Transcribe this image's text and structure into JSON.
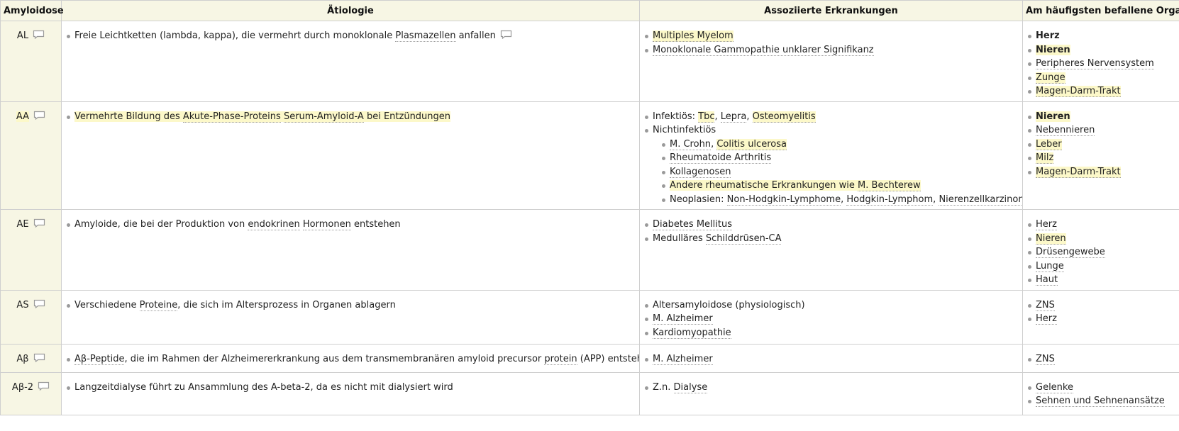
{
  "table": {
    "headers": [
      "Amyloidose",
      "Ätiologie",
      "Assoziierte Erkrankungen",
      "Am häufigsten befallene Organe"
    ],
    "rows": [
      {
        "type": "AL",
        "etiology": [
          "Freie Leichtketten (lambda, kappa), die vermehrt durch monoklonale ",
          "Plasmazellen",
          " anfallen"
        ],
        "diseases": [
          {
            "parts": [
              {
                "t": "Multiples Myelom",
                "hl": true,
                "lk": true
              }
            ]
          },
          {
            "parts": [
              {
                "t": "Monoklonale Gammopathie unklarer Signifikanz",
                "lk": true
              }
            ]
          }
        ],
        "organs": [
          {
            "t": "Herz",
            "b": true
          },
          {
            "t": "Nieren",
            "b": true,
            "hl": true
          },
          {
            "t": "Peripheres Nervensystem",
            "lk": true
          },
          {
            "t": "Zunge",
            "hl": true,
            "lk": true
          },
          {
            "t": "Magen-Darm-Trakt",
            "hl": true,
            "lk": true
          }
        ]
      },
      {
        "type": "AA",
        "etiology": [
          "Vermehrte Bildung des ",
          "Akute-Phase-Proteins",
          " ",
          "Serum-Amyloid-A",
          " bei Entzündungen"
        ],
        "diseases": [
          {
            "parts": [
              {
                "t": "Infektiös: "
              },
              {
                "t": "Tbc",
                "hl": true,
                "lk": true
              },
              {
                "t": ", "
              },
              {
                "t": "Lepra",
                "lk": true
              },
              {
                "t": ", "
              },
              {
                "t": "Osteomyelitis",
                "hl": true,
                "lk": true
              }
            ]
          },
          {
            "parts": [
              {
                "t": "Nichtinfektiös"
              }
            ],
            "sub": [
              {
                "parts": [
                  {
                    "t": "M. Crohn",
                    "lk": true
                  },
                  {
                    "t": ", "
                  },
                  {
                    "t": "Colitis ulcerosa",
                    "hl": true,
                    "lk": true
                  }
                ]
              },
              {
                "parts": [
                  {
                    "t": "Rheumatoide Arthritis",
                    "lk": true
                  }
                ]
              },
              {
                "parts": [
                  {
                    "t": "Kollagenosen",
                    "lk": true
                  }
                ]
              },
              {
                "parts": [
                  {
                    "t": "Andere rheumatische Erkrankungen wie ",
                    "hl": true
                  },
                  {
                    "t": "M. Bechterew",
                    "hl": true,
                    "lk": true
                  }
                ]
              },
              {
                "parts": [
                  {
                    "t": "Neoplasien: "
                  },
                  {
                    "t": "Non-Hodgkin-Lymphome",
                    "lk": true
                  },
                  {
                    "t": ", "
                  },
                  {
                    "t": "Hodgkin-Lymphom",
                    "lk": true
                  },
                  {
                    "t": ", "
                  },
                  {
                    "t": "Nierenzellkarzinom",
                    "lk": true
                  }
                ]
              }
            ]
          }
        ],
        "organs": [
          {
            "t": "Nieren",
            "b": true,
            "hl": true
          },
          {
            "t": "Nebennieren",
            "lk": true
          },
          {
            "t": "Leber",
            "hl": true,
            "lk": true
          },
          {
            "t": "Milz",
            "hl": true,
            "lk": true
          },
          {
            "t": "Magen-Darm-Trakt",
            "hl": true,
            "lk": true
          }
        ]
      },
      {
        "type": "AE",
        "etiology": [
          "Amyloide, die bei der Produktion von ",
          "endokrinen",
          " ",
          "Hormonen",
          " entstehen"
        ],
        "diseases": [
          {
            "parts": [
              {
                "t": "Diabetes Mellitus",
                "lk": true
              }
            ]
          },
          {
            "parts": [
              {
                "t": "Medulläres "
              },
              {
                "t": "Schilddrüsen-CA",
                "lk": true
              }
            ]
          }
        ],
        "organs": [
          {
            "t": "Herz",
            "lk": true
          },
          {
            "t": "Nieren",
            "hl": true,
            "lk": true
          },
          {
            "t": "Drüsengewebe",
            "lk": true
          },
          {
            "t": "Lunge",
            "lk": true
          },
          {
            "t": "Haut",
            "lk": true
          }
        ]
      },
      {
        "type": "AS",
        "etiology": [
          "Verschiedene ",
          "Proteine",
          ", die sich im Altersprozess in Organen ablagern"
        ],
        "diseases": [
          {
            "parts": [
              {
                "t": "Altersamyloidose (physiologisch)"
              }
            ]
          },
          {
            "parts": [
              {
                "t": "M. Alzheimer",
                "lk": true
              }
            ]
          },
          {
            "parts": [
              {
                "t": "Kardiomyopathie",
                "lk": true
              }
            ]
          }
        ],
        "organs": [
          {
            "t": "ZNS",
            "lk": true
          },
          {
            "t": "Herz",
            "lk": true
          }
        ]
      },
      {
        "type": "Aβ",
        "etiology": [
          "Aβ-Peptide",
          ", die im Rahmen der Alzheimererkrankung aus dem transmembranären amyloid precursor ",
          "protein",
          " (APP) entstehen"
        ],
        "diseases": [
          {
            "parts": [
              {
                "t": "M. Alzheimer",
                "lk": true
              }
            ]
          }
        ],
        "organs": [
          {
            "t": "ZNS",
            "lk": true
          }
        ]
      },
      {
        "type": "Aβ-2",
        "etiology": [
          "Langzeitdialyse führt zu Ansammlung des A-beta-2, da es nicht mit dialysiert wird"
        ],
        "diseases": [
          {
            "parts": [
              {
                "t": "Z.n. "
              },
              {
                "t": "Dialyse",
                "lk": true
              }
            ]
          }
        ],
        "organs": [
          {
            "t": "Gelenke",
            "lk": true
          },
          {
            "t": "Sehnen und Sehnenansätze",
            "lk": true
          }
        ]
      }
    ]
  }
}
